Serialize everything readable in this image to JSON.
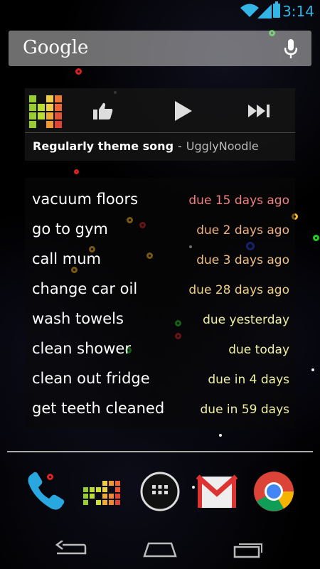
{
  "status_bar": {
    "time": "3:14",
    "accent_color": "#33b5e5",
    "icons": [
      "wifi-icon",
      "signal-icon",
      "battery-icon"
    ]
  },
  "search": {
    "logo_text": "Google",
    "icon": "mic-icon"
  },
  "music_widget": {
    "track_title": "Regularly theme song",
    "separator": "-",
    "artist": "UgglyNoodle",
    "controls": [
      "thumbs-up-icon",
      "play-icon",
      "skip-next-icon"
    ]
  },
  "tasks": {
    "items": [
      {
        "name": "vacuum floors",
        "due": "due 15 days ago",
        "color": "#f08080"
      },
      {
        "name": "go to gym",
        "due": "due 2 days ago",
        "color": "#f0b080"
      },
      {
        "name": "call mum",
        "due": "due 3 days ago",
        "color": "#f0c080"
      },
      {
        "name": "change car oil",
        "due": "due 28 days ago",
        "color": "#f0d080"
      },
      {
        "name": "wash towels",
        "due": "due yesterday",
        "color": "#f0f0a0"
      },
      {
        "name": "clean shower",
        "due": "due today",
        "color": "#f0f0a0"
      },
      {
        "name": "clean out fridge",
        "due": "due in 4 days",
        "color": "#f0f0a0"
      },
      {
        "name": "get teeth cleaned",
        "due": "due in 59 days",
        "color": "#f0f0a0"
      }
    ]
  },
  "dock": {
    "items": [
      "phone-icon",
      "tasks-app-icon",
      "app-drawer-icon",
      "gmail-icon",
      "chrome-icon"
    ]
  },
  "nav": {
    "buttons": [
      "back-icon",
      "home-icon",
      "recents-icon"
    ]
  }
}
